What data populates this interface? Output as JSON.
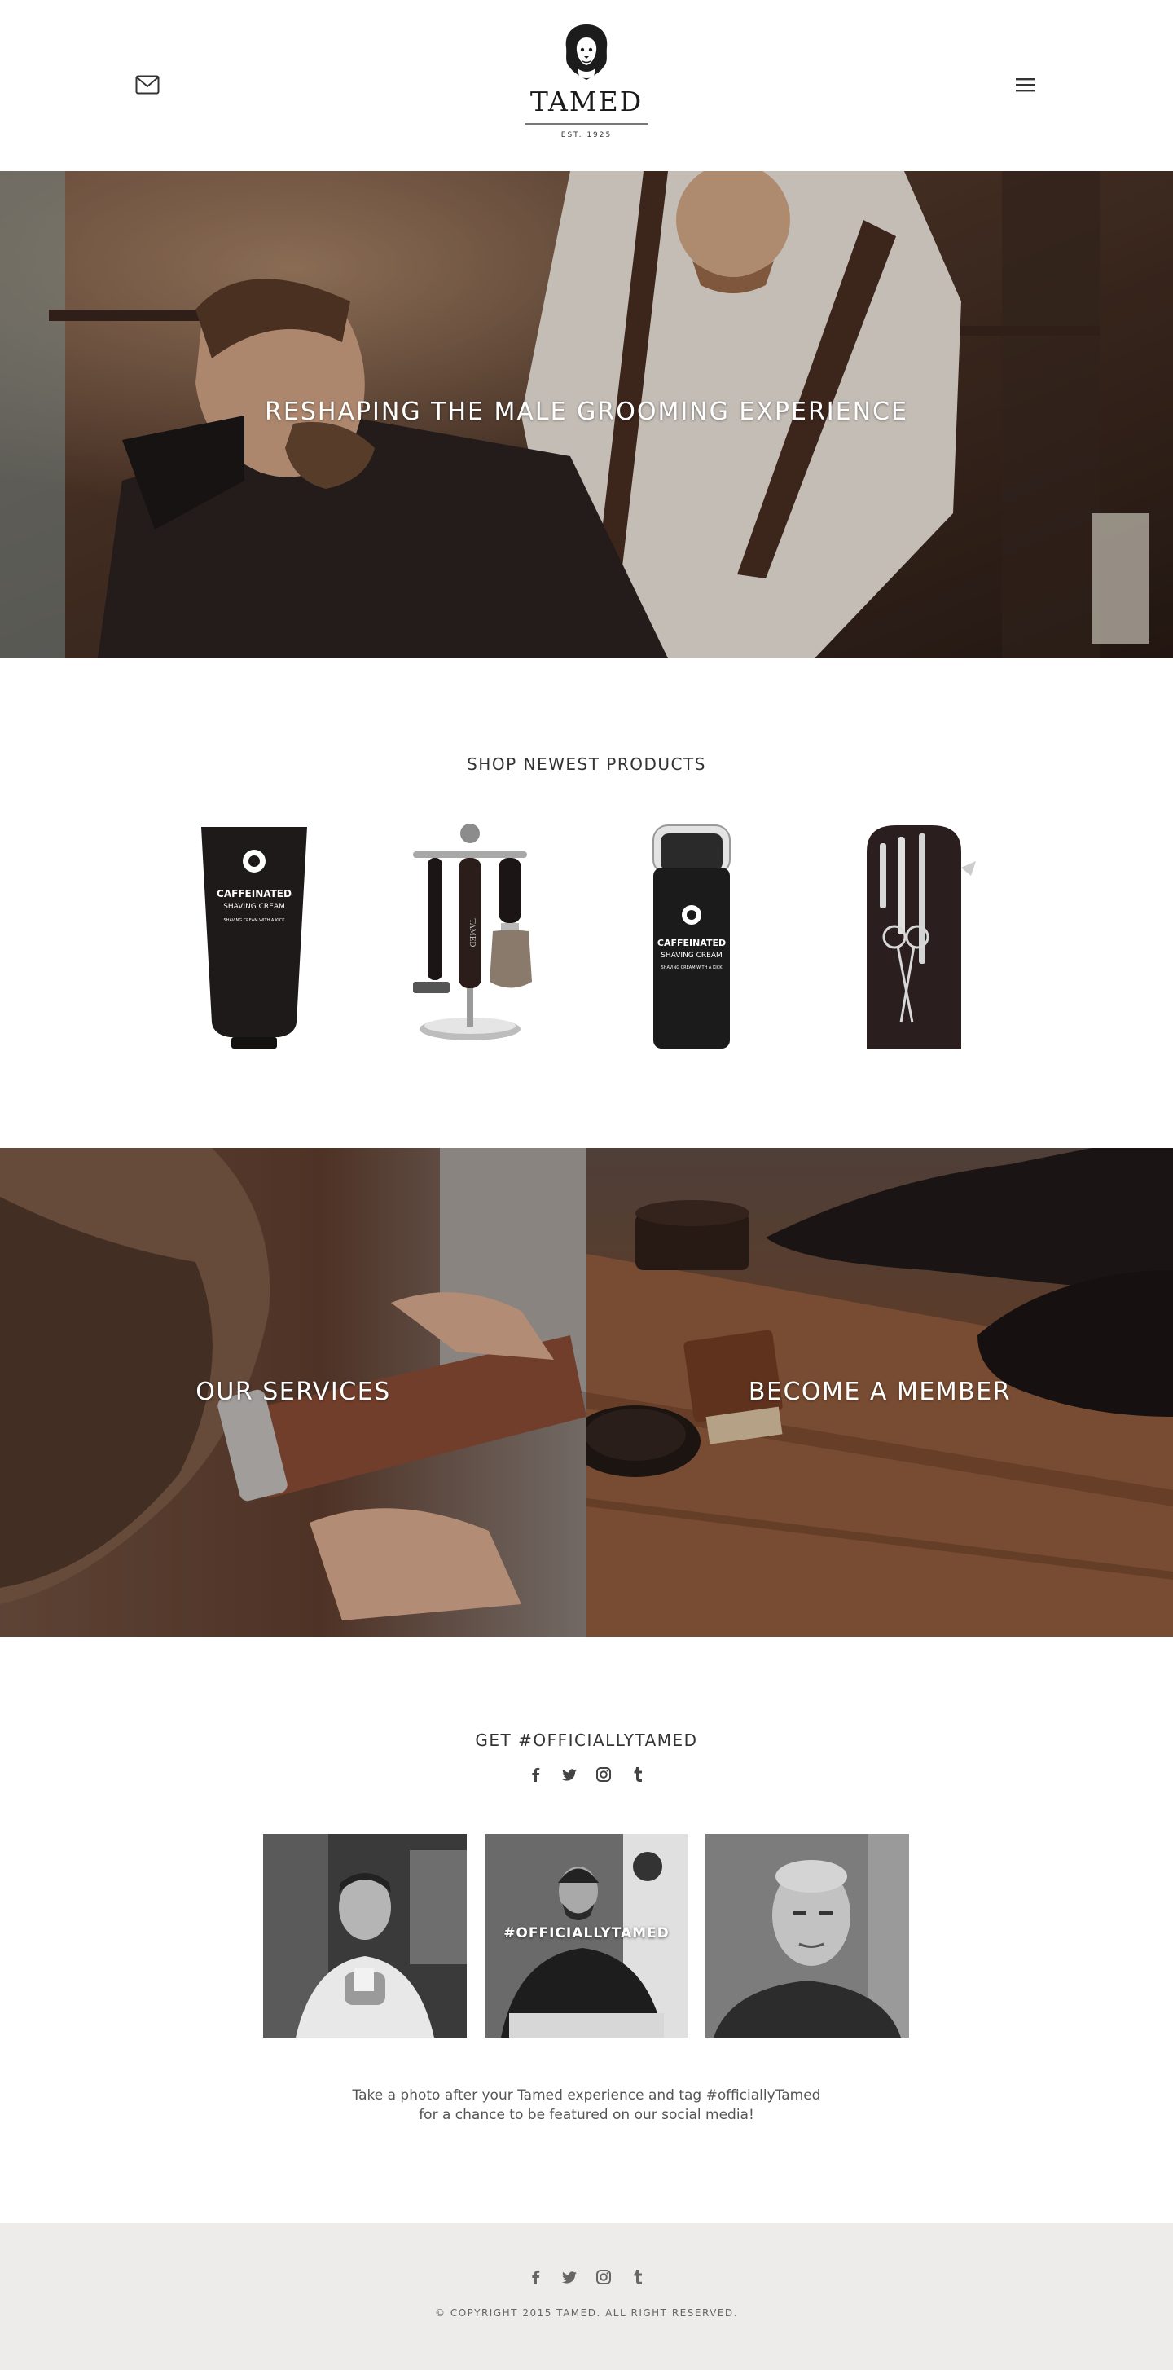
{
  "header": {
    "logo": {
      "name": "TAMED",
      "est": "EST. 1925"
    },
    "mail_icon": "envelope-icon",
    "menu_icon": "hamburger-icon"
  },
  "hero": {
    "title": "RESHAPING THE MALE GROOMING EXPERIENCE"
  },
  "products": {
    "title": "SHOP NEWEST PRODUCTS",
    "items": [
      {
        "kind": "shaving-cream-tube",
        "line1": "CAFFEINATED",
        "line2": "SHAVING CREAM",
        "line3": "SHAVING CREAM WITH A KICK"
      },
      {
        "kind": "razor-brush-stand",
        "brand": "TAMED"
      },
      {
        "kind": "shaving-cream-pump",
        "line1": "CAFFEINATED",
        "line2": "SHAVING CREAM",
        "line3": "SHAVING CREAM WITH A KICK"
      },
      {
        "kind": "grooming-kit"
      }
    ]
  },
  "tiles": {
    "services": "OUR SERVICES",
    "member": "BECOME A MEMBER"
  },
  "social": {
    "title": "GET #OFFICIALLYTAMED",
    "icons": [
      "facebook-icon",
      "twitter-icon",
      "instagram-icon",
      "tumblr-icon"
    ],
    "photo_tag": "#OFFICIALLYTAMED",
    "caption_line1": "Take a photo after your Tamed experience and tag #officiallyTamed",
    "caption_line2": "for a chance to be featured on our social media!"
  },
  "footer": {
    "copyright": "© COPYRIGHT 2015 TAMED. ALL RIGHT RESERVED."
  },
  "colors": {
    "footer_bg": "#edeceb",
    "text": "#333333",
    "hero_overlay": "#3a2a22"
  }
}
